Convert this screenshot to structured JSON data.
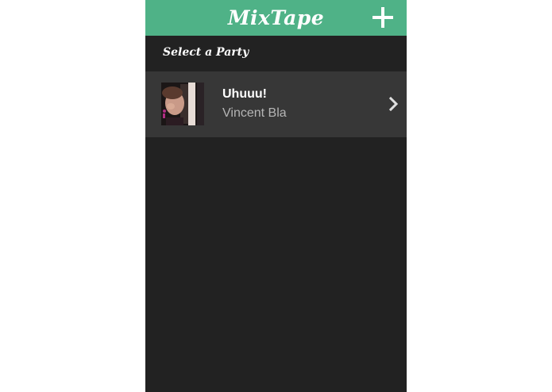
{
  "header": {
    "title": "MixTape",
    "add_icon": "plus-icon",
    "background_color": "#4fb287"
  },
  "section": {
    "label": "Select a Party"
  },
  "parties": [
    {
      "title": "Uhuuu!",
      "owner": "Vincent Bla",
      "avatar_icon": "avatar-photo",
      "chevron_icon": "chevron-right-icon"
    }
  ],
  "colors": {
    "background": "#222222",
    "row_background": "#373737",
    "accent": "#4fb287"
  }
}
